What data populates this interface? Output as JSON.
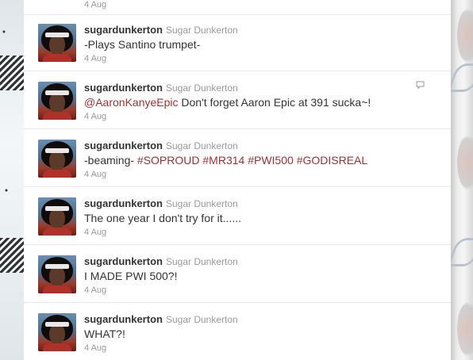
{
  "partial_tweet": {
    "timestamp": "4 Aug"
  },
  "tweets": [
    {
      "screen_name": "sugardunkerton",
      "full_name": "Sugar Dunkerton",
      "text": "-Plays Santino trumpet-",
      "timestamp": "4 Aug"
    },
    {
      "screen_name": "sugardunkerton",
      "full_name": "Sugar Dunkerton",
      "mention": "@AaronKanyeEpic",
      "text": " Don't forget Aaron Epic at 391 sucka~!",
      "timestamp": "4 Aug",
      "icon": "reply-icon"
    },
    {
      "screen_name": "sugardunkerton",
      "full_name": "Sugar Dunkerton",
      "text": "-beaming- ",
      "hashtags": [
        "#SOPROUD",
        "#MR314",
        "#PWI500",
        "#GODISREAL"
      ],
      "timestamp": "4 Aug"
    },
    {
      "screen_name": "sugardunkerton",
      "full_name": "Sugar Dunkerton",
      "text": "The one year I don't try for it......",
      "timestamp": "4 Aug"
    },
    {
      "screen_name": "sugardunkerton",
      "full_name": "Sugar Dunkerton",
      "text": "I MADE PWI 500?!",
      "timestamp": "4 Aug"
    },
    {
      "screen_name": "sugardunkerton",
      "full_name": "Sugar Dunkerton",
      "text": "WHAT?!",
      "timestamp": "4 Aug"
    }
  ],
  "colors": {
    "link": "#993333",
    "meta": "#999999",
    "text": "#333333",
    "divider": "#e6e6e6"
  }
}
